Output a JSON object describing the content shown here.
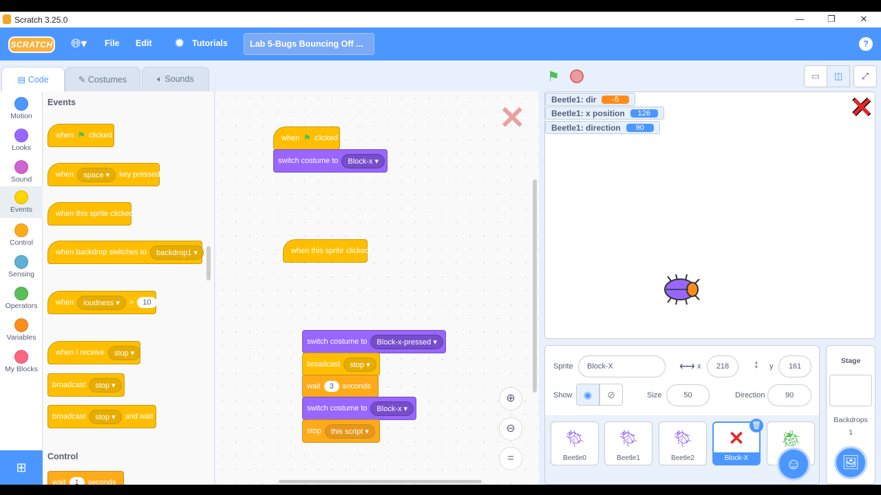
{
  "window": {
    "title": "Scratch 3.25.0",
    "minimize": "—",
    "restore": "❐",
    "close": "✕"
  },
  "menu": {
    "logo": "SCRATCH",
    "file": "File",
    "edit": "Edit",
    "tutorials": "Tutorials",
    "project_title": "Lab 5-Bugs Bouncing Off ...",
    "help": "?"
  },
  "tabs": {
    "code": "Code",
    "costumes": "Costumes",
    "sounds": "Sounds"
  },
  "categories": [
    {
      "label": "Motion",
      "color": "#4c97ff"
    },
    {
      "label": "Looks",
      "color": "#9966ff"
    },
    {
      "label": "Sound",
      "color": "#cf63cf"
    },
    {
      "label": "Events",
      "color": "#ffd500"
    },
    {
      "label": "Control",
      "color": "#ffab19"
    },
    {
      "label": "Sensing",
      "color": "#5cb1d6"
    },
    {
      "label": "Operators",
      "color": "#59c059"
    },
    {
      "label": "Variables",
      "color": "#ff8c1a"
    },
    {
      "label": "My Blocks",
      "color": "#ff6680"
    }
  ],
  "palette": {
    "events_title": "Events",
    "control_title": "Control",
    "b_flag_when": "when",
    "b_flag_clicked": "clicked",
    "b_key_when": "when",
    "b_key_value": "space",
    "b_key_pressed": "key pressed",
    "b_sprite_clicked": "when this sprite clicked",
    "b_backdrop_text": "when backdrop switches to",
    "b_backdrop_value": "backdrop1",
    "b_greater_when": "when",
    "b_greater_value": "loudness",
    "b_greater_op": ">",
    "b_greater_num": "10",
    "b_receive_text": "when I receive",
    "b_receive_value": "stop",
    "b_broadcast_text": "broadcast",
    "b_broadcast_value": "stop",
    "b_bwait_text": "broadcast",
    "b_bwait_value": "stop",
    "b_bwait_suffix": "and wait",
    "b_wait_text": "wait",
    "b_wait_num": "1",
    "b_wait_suffix": "seconds"
  },
  "scripts": {
    "s1_when": "when",
    "s1_clicked": "clicked",
    "s1_switch": "switch costume to",
    "s1_costume": "Block-x",
    "s2_sprite_clicked": "when this sprite clicked",
    "s3_switch": "switch costume to",
    "s3_costume": "Block-x-pressed",
    "s3_broadcast": "broadcast",
    "s3_broadcast_value": "stop",
    "s3_wait": "wait",
    "s3_wait_num": "3",
    "s3_wait_suffix": "seconds",
    "s3_switch2": "switch costume to",
    "s3_costume2": "Block-x",
    "s3_stop": "stop",
    "s3_stop_value": "this script"
  },
  "monitors": [
    {
      "label": "Beetle1: dir",
      "value": "-5",
      "color": "#ff8c1a"
    },
    {
      "label": "Beetle1: x position",
      "value": "126",
      "color": "#4c97ff"
    },
    {
      "label": "Beetle1: direction",
      "value": "90",
      "color": "#4c97ff"
    }
  ],
  "sprite_info": {
    "sprite_label": "Sprite",
    "sprite_name": "Block-X",
    "x_label": "x",
    "x_value": "218",
    "y_label": "y",
    "y_value": "161",
    "show_label": "Show",
    "size_label": "Size",
    "size_value": "50",
    "direction_label": "Direction",
    "direction_value": "90"
  },
  "sprites": [
    "Beetle0",
    "Beetle1",
    "Beetle2",
    "Block-X",
    "B"
  ],
  "stage_pane": {
    "title": "Stage",
    "backdrops_label": "Backdrops",
    "backdrops_count": "1"
  }
}
